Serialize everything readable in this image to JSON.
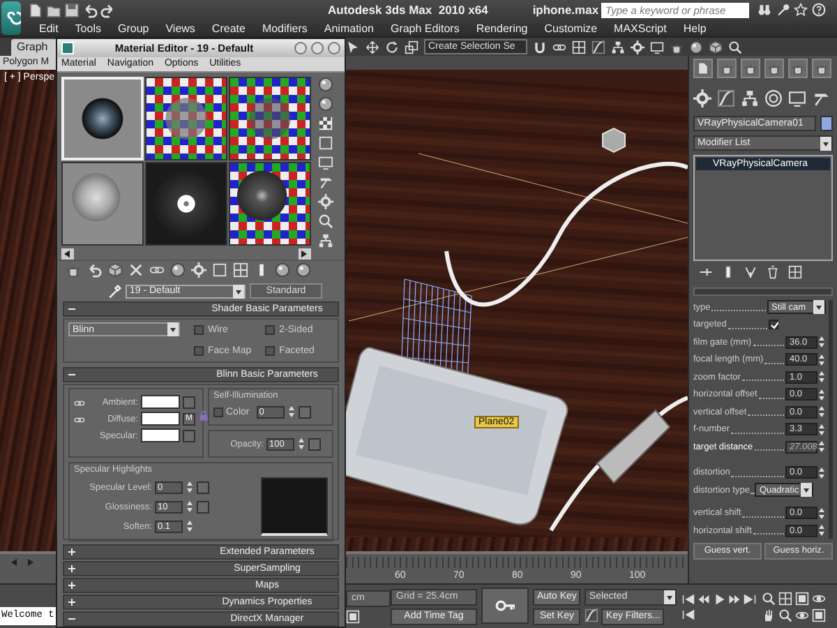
{
  "app": {
    "title": "Autodesk 3ds Max  2010 x64",
    "file": "iphone.max",
    "search": {
      "placeholder": "Type a keyword or phrase"
    }
  },
  "menu": [
    "Edit",
    "Tools",
    "Group",
    "Views",
    "Create",
    "Modifiers",
    "Animation",
    "Graph Editors",
    "Rendering",
    "Customize",
    "MAXScript",
    "Help"
  ],
  "ribbon": {
    "tab": "Graph",
    "panel": "Polygon M"
  },
  "toolbar": {
    "selection_set": "Create Selection Se"
  },
  "viewport": {
    "label": "[ + ] Perspe",
    "object_tag": "Plane02"
  },
  "material_editor": {
    "title": "Material Editor - 19 - Default",
    "menu": [
      "Material",
      "Navigation",
      "Options",
      "Utilities"
    ],
    "samples": [
      {
        "selected": true
      },
      {
        "selected": false
      },
      {
        "selected": false
      },
      {
        "selected": false
      },
      {
        "selected": false
      },
      {
        "selected": false
      }
    ],
    "material_name": "19 - Default",
    "material_type": "Standard",
    "rollouts": [
      {
        "kind": "shader",
        "title": "Shader Basic Parameters",
        "expanded": true,
        "shader": "Blinn",
        "options": [
          {
            "label": "Wire",
            "checked": false
          },
          {
            "label": "2-Sided",
            "checked": false
          },
          {
            "label": "Face Map",
            "checked": false
          },
          {
            "label": "Faceted",
            "checked": false
          }
        ]
      },
      {
        "kind": "blinn",
        "title": "Blinn Basic Parameters",
        "expanded": true,
        "colors": [
          {
            "label": "Ambient:"
          },
          {
            "label": "Diffuse:"
          },
          {
            "label": "Specular:"
          }
        ],
        "map_button": "M",
        "self_illumination": {
          "title": "Self-Illumination",
          "label": "Color",
          "checked": false,
          "value": "0"
        },
        "opacity": {
          "label": "Opacity:",
          "value": "100"
        },
        "highlights": {
          "title": "Specular Highlights",
          "rows": [
            {
              "label": "Specular Level:",
              "value": "0"
            },
            {
              "label": "Glossiness:",
              "value": "10"
            },
            {
              "label": "Soften:",
              "value": "0.1"
            }
          ]
        }
      },
      {
        "kind": "plain",
        "title": "Extended Parameters",
        "expanded": false
      },
      {
        "kind": "plain",
        "title": "SuperSampling",
        "expanded": false
      },
      {
        "kind": "plain",
        "title": "Maps",
        "expanded": false
      },
      {
        "kind": "plain",
        "title": "Dynamics Properties",
        "expanded": false
      },
      {
        "kind": "plain",
        "title": "DirectX Manager",
        "expanded": true
      }
    ]
  },
  "command_panel": {
    "object_name": "VRayPhysicalCamera01",
    "modifier_list": "Modifier List",
    "stack": [
      {
        "label": "VRayPhysicalCamera",
        "selected": true
      }
    ],
    "params": [
      {
        "kind": "dropdown",
        "label": "type",
        "value": "Still cam",
        "disabled": false
      },
      {
        "kind": "check",
        "label": "targeted",
        "checked": true,
        "disabled": false
      },
      {
        "kind": "spinner",
        "label": "film gate (mm)",
        "value": "36.0",
        "disabled": false
      },
      {
        "kind": "spinner",
        "label": "focal length (mm)",
        "value": "40.0",
        "disabled": false
      },
      {
        "kind": "spinner",
        "label": "zoom factor",
        "value": "1.0",
        "disabled": false
      },
      {
        "kind": "spinner",
        "label": "horizontal offset",
        "value": "0.0",
        "disabled": false
      },
      {
        "kind": "spinner",
        "label": "vertical offset",
        "value": "0.0",
        "disabled": false
      },
      {
        "kind": "spinner",
        "label": "f-number",
        "value": "3.3",
        "disabled": false
      },
      {
        "kind": "spinner",
        "label": "target distance",
        "value": "27.008",
        "disabled": true
      },
      {
        "kind": "spinner",
        "label": "distortion",
        "value": "0.0",
        "disabled": false
      },
      {
        "kind": "dropdown",
        "label": "distortion type",
        "value": "Quadratic",
        "disabled": false
      },
      {
        "kind": "spinner",
        "label": "vertical shift",
        "value": "0.0",
        "disabled": false
      },
      {
        "kind": "spinner",
        "label": "horizontal shift",
        "value": "0.0",
        "disabled": false
      }
    ],
    "buttons": [
      "Guess vert.",
      "Guess horiz."
    ]
  },
  "timeline": {
    "ticks": [
      "60",
      "70",
      "80",
      "90",
      "100"
    ]
  },
  "status_bar": {
    "listener": "Welcome t",
    "unit": "cm",
    "grid": "Grid = 25.4cm",
    "time_tag": "Add Time Tag",
    "auto_key": "Auto Key",
    "set_key": "Set Key",
    "key_mode": "Selected",
    "key_filters": "Key Filters..."
  }
}
